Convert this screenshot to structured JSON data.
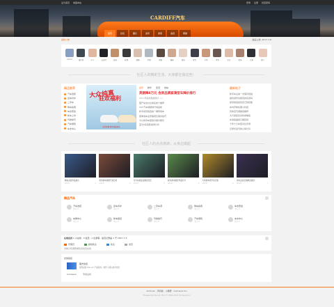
{
  "topbar": {
    "left": [
      "设为首页",
      "收藏本站"
    ],
    "right": [
      "登录",
      "注册",
      "找回密码"
    ]
  },
  "hero": {
    "logo_text": "CARDIFF汽车"
  },
  "nav": {
    "items": [
      "首页",
      "论坛",
      "图片",
      "资讯",
      "搜索",
      "会员",
      "帮助"
    ],
    "active_index": 0
  },
  "subbar": {
    "left": "最新公告",
    "right": "最后上线: 2017-7-6"
  },
  "members": [
    {
      "name": "admin",
      "color": "#8aa0c0"
    },
    {
      "name": "漫步者",
      "color": "#404850"
    },
    {
      "name": "小小",
      "color": "#e0b8a0"
    },
    {
      "name": "丘比特",
      "color": "#202228"
    },
    {
      "name": "蓝色",
      "color": "#c0906a"
    },
    {
      "name": "秋风",
      "color": "#3a3a3a"
    },
    {
      "name": "静静",
      "color": "#d8c0b0"
    },
    {
      "name": "阿里",
      "color": "#b0b8c0"
    },
    {
      "name": "雨辰",
      "color": "#5a4a40"
    },
    {
      "name": "猫咪",
      "color": "#d0a890"
    },
    {
      "name": "微凉",
      "color": "#e6d0c4"
    },
    {
      "name": "星空",
      "color": "#3c3f48"
    },
    {
      "name": "小鱼",
      "color": "#c89878"
    },
    {
      "name": "木木",
      "color": "#6a5850"
    },
    {
      "name": "豆豆",
      "color": "#dcbca8"
    },
    {
      "name": "晴天",
      "color": "#a88070"
    },
    {
      "name": "芒果",
      "color": "#2f3036"
    },
    {
      "name": "路人",
      "color": "#e8c8b8"
    }
  ],
  "section_titles": {
    "s1": "社区人的精彩生活，大家都在做这些！",
    "s2": "社区人的点点滴滴，从身边做起"
  },
  "featured": {
    "left_title": "精品推荐",
    "left_items": [
      "汽车改装",
      "爱车养护",
      "二手车",
      "购车指南",
      "车友聚会",
      "新车上市",
      "驾驶技巧",
      "汽车保险",
      "车友中心"
    ],
    "banner": {
      "line1": "大众纯真",
      "line2": "狂欢福利",
      "footer": "全系特惠 购车即送好礼"
    },
    "tabs": [
      "资讯",
      "精华",
      "置顶",
      "热帖"
    ],
    "headline": "英朗降8万元 合资品牌紧凑型车降价排行",
    "subline": "2017年最新数据统计 >>",
    "links": [
      "国产车性价比排名前十推荐",
      "SUV汽车销量排行榜最新",
      "新手如何挑选第一辆家用车",
      "夏季用车注意事项及保养技巧",
      "大众新款车型官方报价曝光",
      "宝马5系改装案例分享"
    ],
    "right_title": "最新帖子",
    "right_links": [
      "新手车主第一次保养经验",
      "座椅通风功能真的实用吗",
      "如何挑选适合自己的轮胎",
      "车内异味处理小妙招",
      "周末自驾游路线推荐",
      "大灯改装合法吗求解答",
      "车漆镀晶和打蜡区别",
      "十年十大车型对比评测",
      "记录长途驾驶心得分享"
    ]
  },
  "gallery": [
    {
      "caption": "精彩改装作品展示",
      "user": "admin",
      "count": "2",
      "color": "#3a5a8a"
    },
    {
      "caption": "黄色跑车靓丽写真赏析",
      "user": "admin",
      "count": "5",
      "color": "#7a4a3a"
    },
    {
      "caption": "宝马车模美女图片欣赏",
      "user": "admin",
      "count": "3",
      "color": "#4a7a6a"
    },
    {
      "caption": "绿色跑车摄影作品分享",
      "user": "admin",
      "count": "4",
      "color": "#5a8a4a"
    },
    {
      "caption": "大黄蜂车模写真合集",
      "user": "admin",
      "count": "6",
      "color": "#b08a2a"
    },
    {
      "caption": "豪车美女街拍精选集锦",
      "user": "admin",
      "count": "1",
      "color": "#3a3050"
    }
  ],
  "forum": {
    "title": "精品汽车",
    "boards": [
      {
        "name": "汽车改装",
        "count": "今日: 0"
      },
      {
        "name": "爱车养护",
        "count": "今日: 0"
      },
      {
        "name": "二手车源",
        "count": "今日: 0"
      },
      {
        "name": "购车指南",
        "count": "今日: 0"
      },
      {
        "name": "车友聚会",
        "count": "今日: 0"
      },
      {
        "name": "车辆中心",
        "count": "今日: 0"
      },
      {
        "name": "新车报道",
        "count": "今日: 0"
      },
      {
        "name": "驾驶技巧",
        "count": "今日: 0"
      },
      {
        "name": "汽车保险",
        "count": "今日: 0"
      },
      {
        "name": "车友中心",
        "count": "今日: 0"
      }
    ]
  },
  "stats": {
    "online_label": "在线会员",
    "online_text": "1 人在线 · 0 会员 · 1 位游客 · 最高记录是 1 于 2017-7-5",
    "legend": [
      {
        "label": "管理员",
        "color": "#ff6600"
      },
      {
        "label": "超级版主",
        "color": "#4a9a4a"
      },
      {
        "label": "版主",
        "color": "#2d8ae0"
      },
      {
        "label": "会员",
        "color": "#aaaaaa"
      }
    ],
    "note": "当前只有游客或隐身会员在线"
  },
  "info": {
    "row1": "友情链接",
    "promo_title": "官方论坛",
    "promo_desc": "提供最新 Discuz! 产品新闻、软件下载与技术交流",
    "contact_label": "Comsenz",
    "contact_value": "专用主机"
  },
  "footer": {
    "line1": "Archiver · 手机版 · 小黑屋 · Comsenz Inc.",
    "line2": "Powered by Discuz! X3.2 © 2001-2013 Comsenz Inc."
  }
}
